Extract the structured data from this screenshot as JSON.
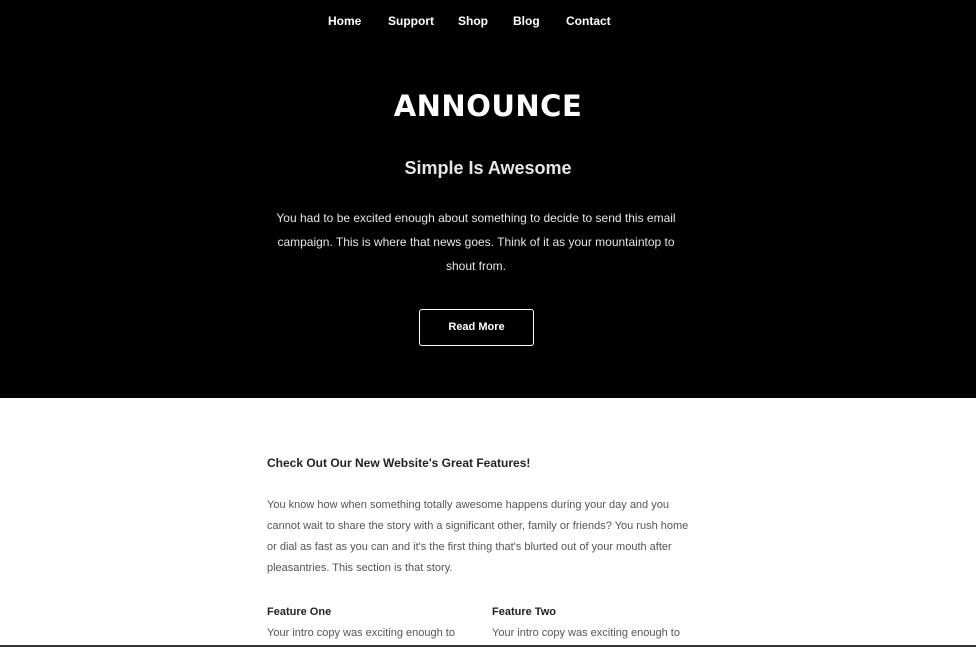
{
  "nav": {
    "items": [
      {
        "label": "Home"
      },
      {
        "label": "Support"
      },
      {
        "label": "Shop"
      },
      {
        "label": "Blog"
      },
      {
        "label": "Contact"
      }
    ]
  },
  "hero": {
    "logo": "ANNOUNCE",
    "headline": "Simple Is Awesome",
    "copy": "You had to be excited enough about something to decide to send this email campaign. This is where that news goes. Think of it as your mountaintop to shout from.",
    "button_label": "Read More"
  },
  "content": {
    "section_title": "Check Out Our New Website's Great Features!",
    "section_body": "You know how when something totally awesome happens during your day and you cannot wait to share the story with a significant other, family or friends? You rush home or dial as fast as you can and it's the first thing that's blurted out of your mouth after pleasantries. This section is that story.",
    "features": [
      {
        "title": "Feature One",
        "copy": "Your intro copy was exciting enough to"
      },
      {
        "title": "Feature Two",
        "copy": "Your intro copy was exciting enough to"
      }
    ]
  }
}
